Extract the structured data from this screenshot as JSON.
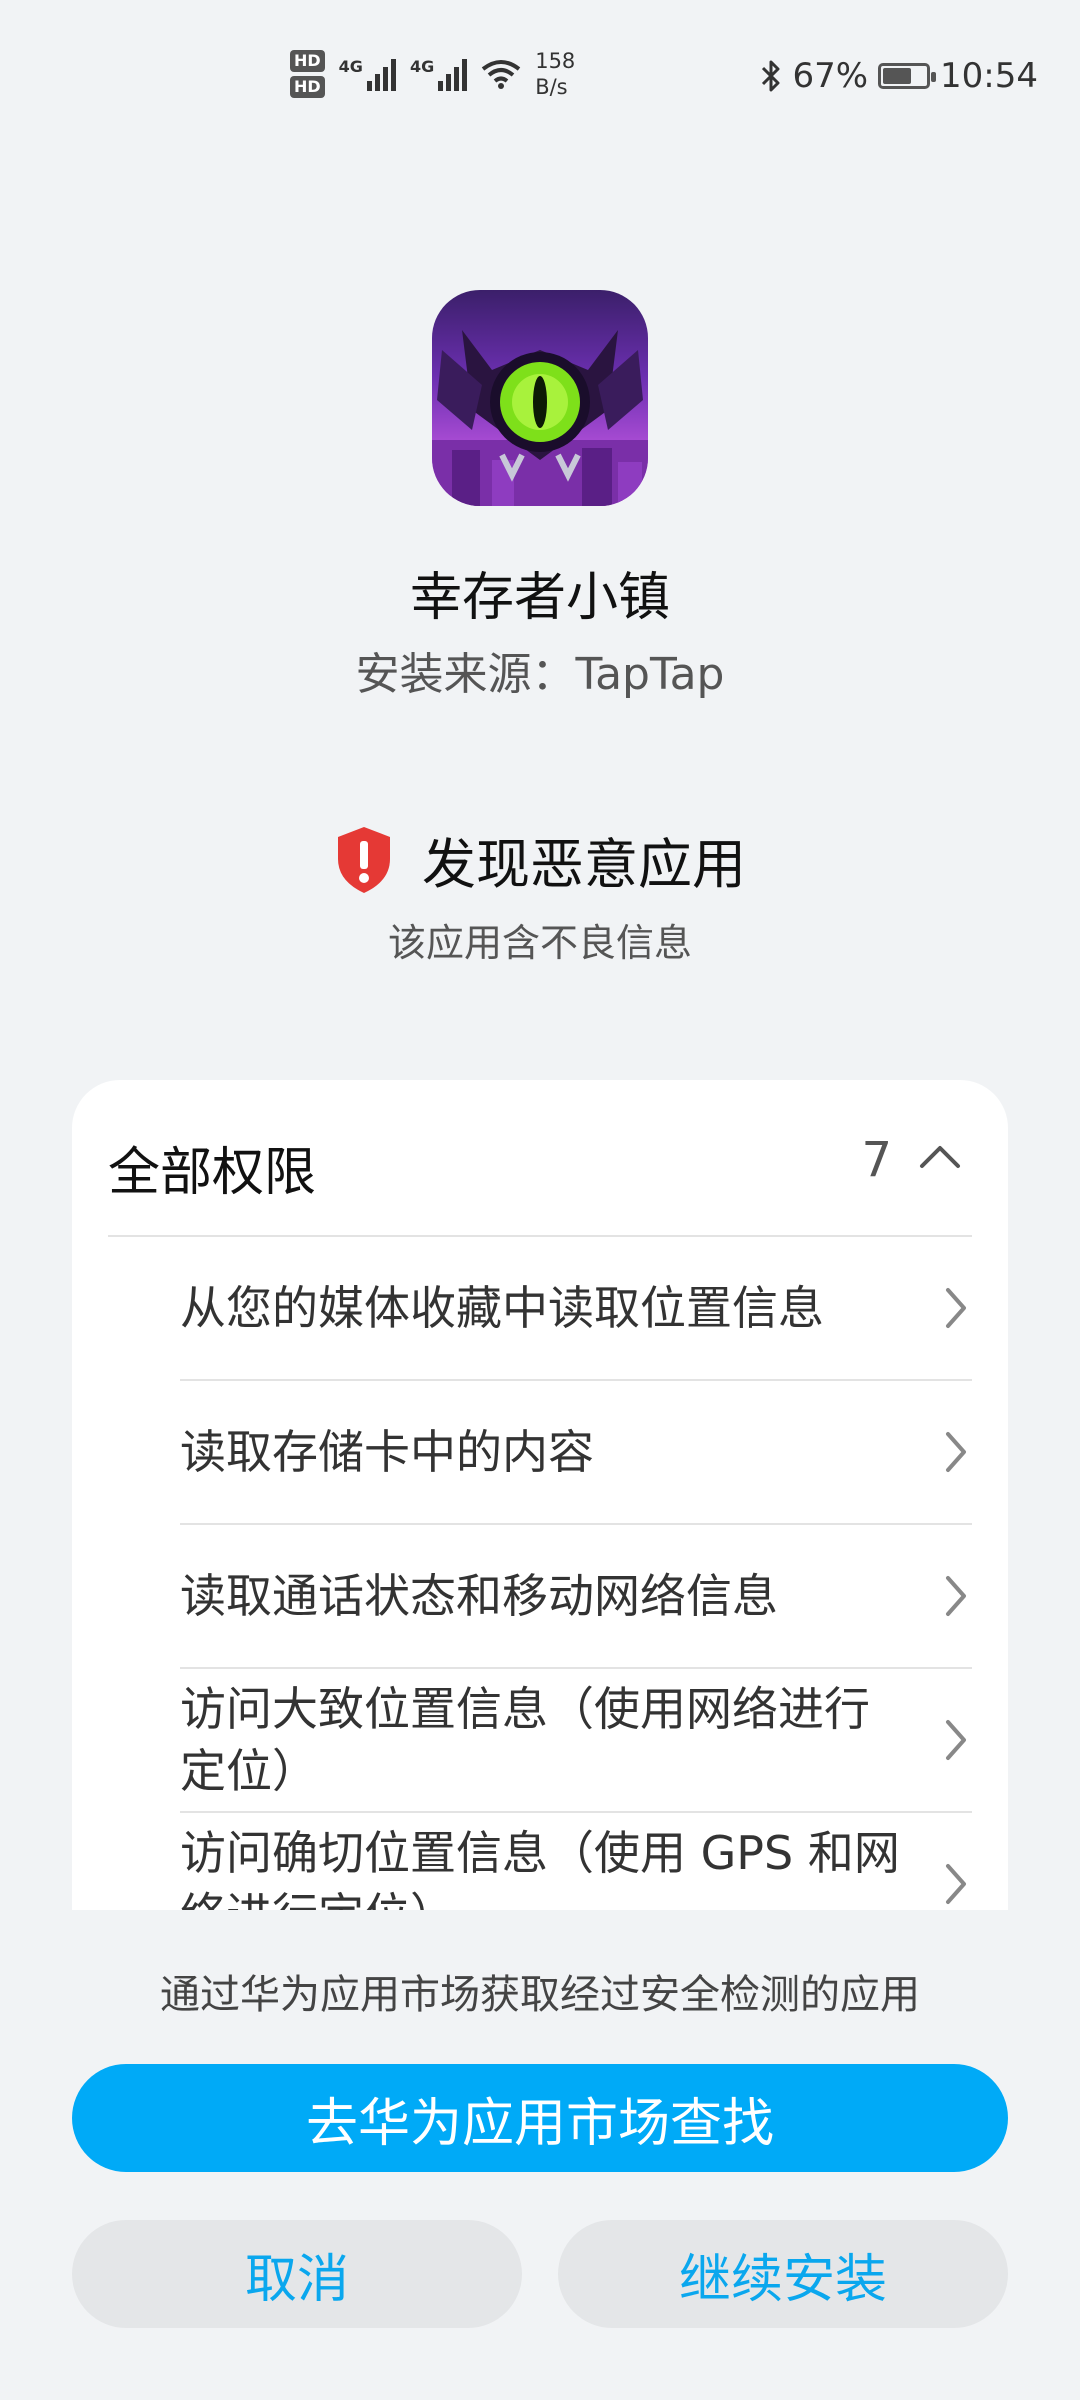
{
  "status_bar": {
    "hd1": "HD",
    "hd2": "HD",
    "network1": "4G",
    "network2": "4G",
    "speed_value": "158",
    "speed_unit": "B/s",
    "battery": "67%",
    "battery_level": 0.67,
    "time": "10:54"
  },
  "app": {
    "name": "幸存者小镇",
    "source": "安装来源：TapTap",
    "icon": "monster-eye-app-icon"
  },
  "warning": {
    "title": "发现恶意应用",
    "subtitle": "该应用含不良信息",
    "icon": "shield-alert-icon",
    "color": "#e53935"
  },
  "permissions": {
    "title": "全部权限",
    "count": "7",
    "items": [
      {
        "label": "从您的媒体收藏中读取位置信息"
      },
      {
        "label": "读取存储卡中的内容"
      },
      {
        "label": "读取通话状态和移动网络信息"
      },
      {
        "label": "访问大致位置信息（使用网络进行定位）"
      },
      {
        "label": "访问确切位置信息（使用 GPS 和网络进行定位）"
      }
    ]
  },
  "info_text": "通过华为应用市场获取经过安全检测的应用",
  "buttons": {
    "primary": "去华为应用市场查找",
    "cancel": "取消",
    "continue": "继续安装"
  },
  "colors": {
    "accent": "#00aaf7",
    "secondary_text_button": "#0aa7ee",
    "background": "#f1f3f5"
  }
}
